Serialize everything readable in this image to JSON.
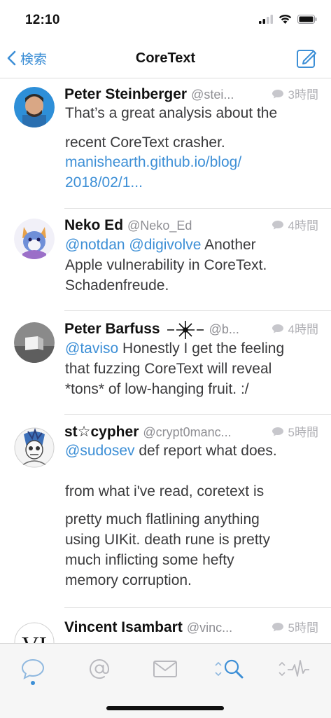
{
  "status_bar": {
    "time": "12:10"
  },
  "nav": {
    "back_label": "検索",
    "title": "CoreText"
  },
  "tweets": [
    {
      "name": "Peter Steinberger",
      "handle": "@stei...",
      "time": "3時間",
      "lines": [
        [
          {
            "text": "That’s a great analysis about the"
          }
        ],
        [
          {
            "text": "recent CoreText crasher."
          }
        ],
        [
          {
            "text": "manishearth.github.io/blog/",
            "link": true
          }
        ],
        [
          {
            "text": "2018/02/1...",
            "link": true
          }
        ]
      ]
    },
    {
      "name": "Neko Ed",
      "handle": "@Neko_Ed",
      "time": "4時間",
      "lines": [
        [
          {
            "text": "@notdan",
            "link": true
          },
          {
            "text": " "
          },
          {
            "text": "@digivolve",
            "link": true
          },
          {
            "text": " Another"
          }
        ],
        [
          {
            "text": "Apple vulnerability in CoreText."
          }
        ],
        [
          {
            "text": "Schadenfreude."
          }
        ]
      ]
    },
    {
      "name": "Peter Barfuss",
      "handle": "@b...",
      "time": "4時間",
      "lines": [
        [
          {
            "text": "@taviso",
            "link": true
          },
          {
            "text": " Honestly I get the feeling"
          }
        ],
        [
          {
            "text": "that fuzzing CoreText will reveal"
          }
        ],
        [
          {
            "text": "*tons* of low-hanging fruit. :/"
          }
        ]
      ]
    },
    {
      "name": "st☆cypher",
      "handle": "@crypt0manc...",
      "time": "5時間",
      "lines": [
        [
          {
            "text": "@sudosev",
            "link": true
          },
          {
            "text": " def report what does."
          }
        ],
        [
          {
            "text": "from what i've read, coretext is"
          }
        ],
        [
          {
            "text": "pretty much flatlining anything"
          }
        ],
        [
          {
            "text": "using UIKit. death rune is pretty"
          }
        ],
        [
          {
            "text": "much inflicting some hefty"
          }
        ],
        [
          {
            "text": "memory corruption."
          }
        ]
      ]
    },
    {
      "name": "Vincent Isambart",
      "handle": "@vinc...",
      "time": "5時間",
      "lines": []
    }
  ],
  "tab_bar": {
    "tabs": [
      {
        "icon": "speech-bubble-icon",
        "active": true
      },
      {
        "icon": "at-sign-icon",
        "active": false
      },
      {
        "icon": "envelope-icon",
        "active": false
      },
      {
        "icon": "search-icon",
        "active": true
      },
      {
        "icon": "activity-icon",
        "active": false
      }
    ]
  },
  "colors": {
    "accent": "#3d8fd6",
    "secondary_text": "#8e8e93",
    "body_text": "#3a3a3c"
  }
}
